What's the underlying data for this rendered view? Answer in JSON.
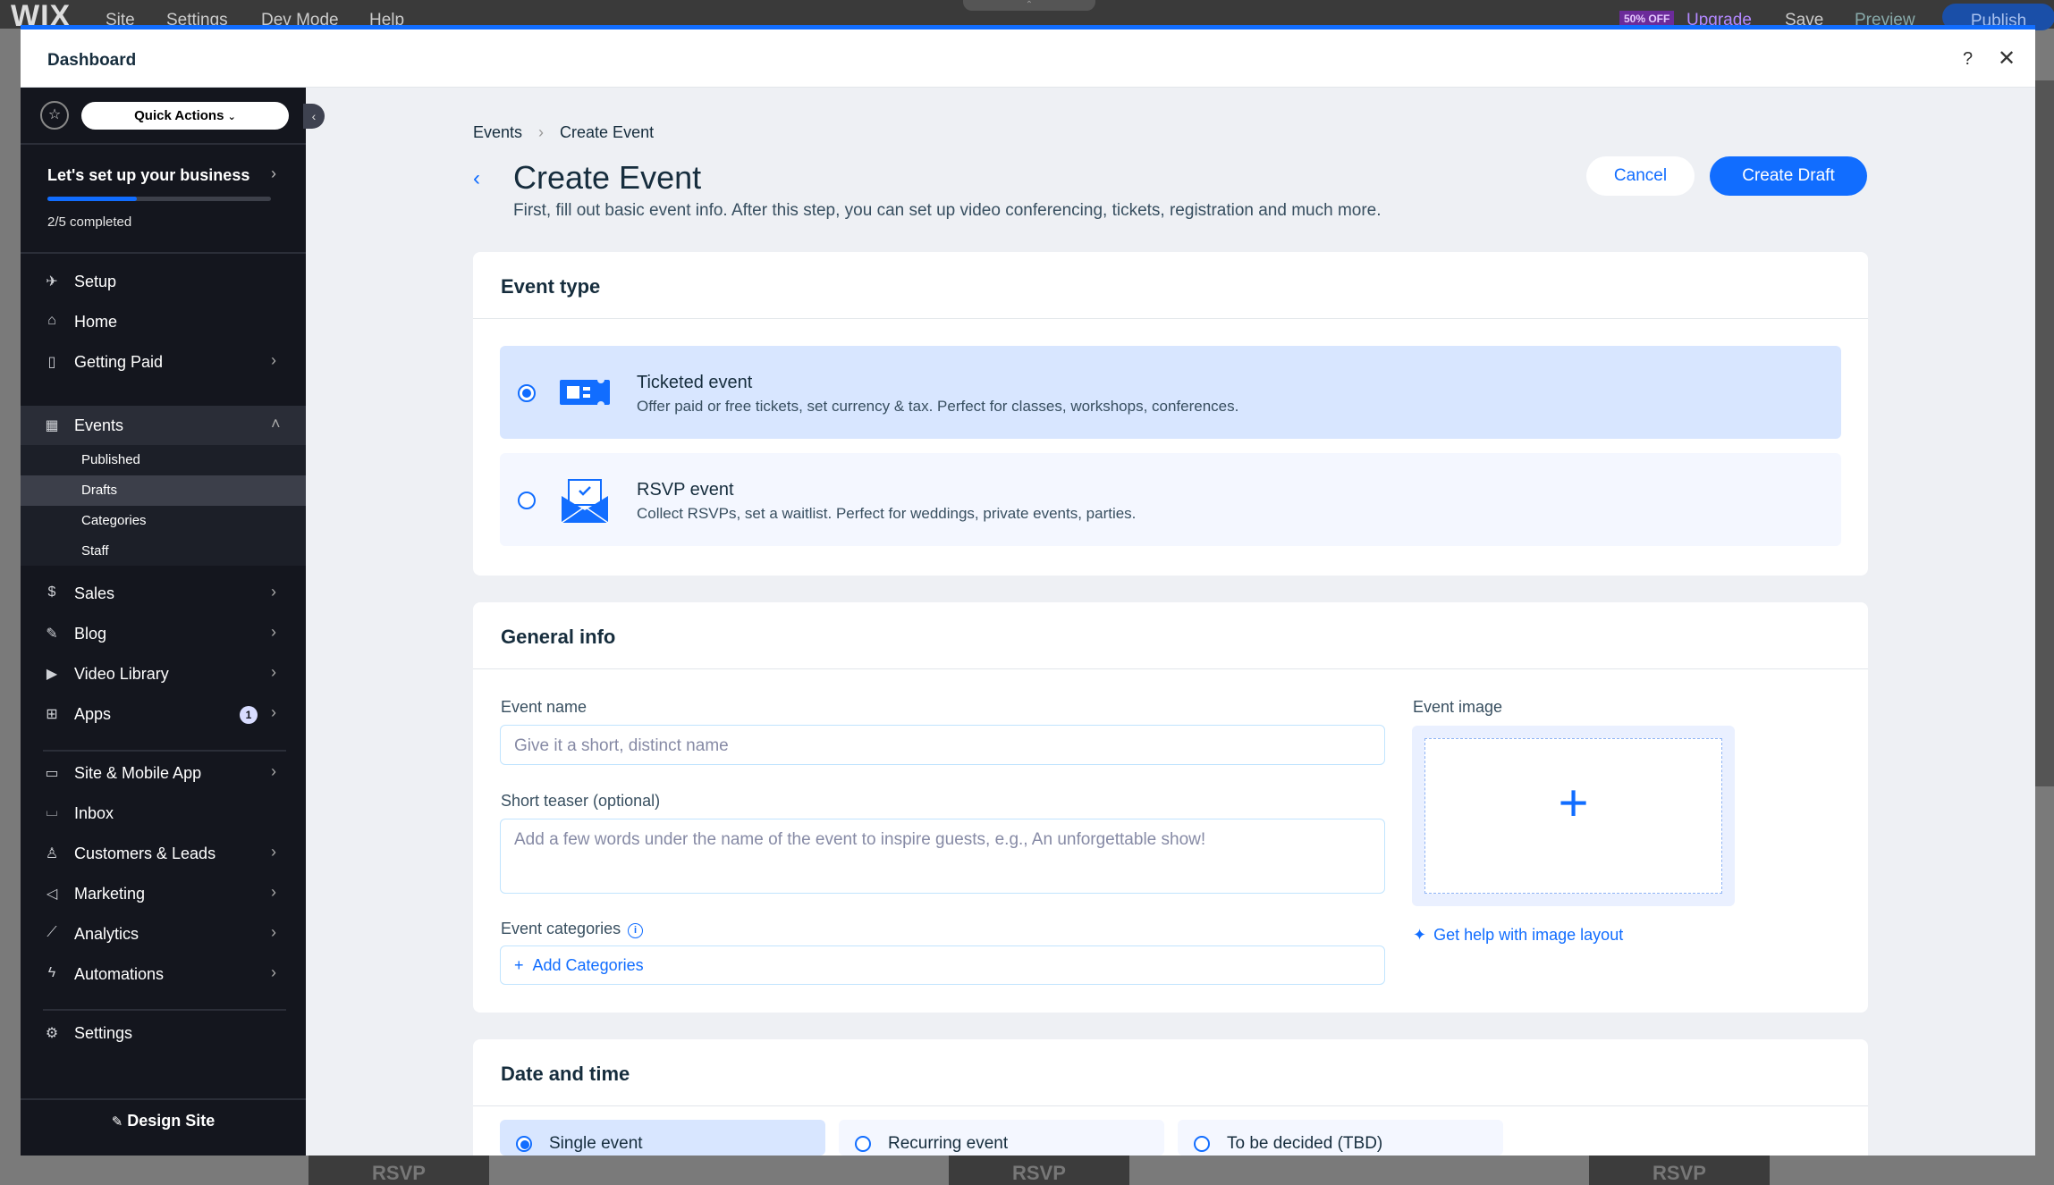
{
  "editor_bar": {
    "logo": "WIX",
    "menu": [
      "Site",
      "Settings",
      "Dev Mode",
      "Help"
    ],
    "promo_badge": "50% OFF",
    "upgrade": "Upgrade",
    "save": "Save",
    "preview": "Preview",
    "publish": "Publish"
  },
  "background_tiles": [
    "RSVP",
    "RSVP",
    "RSVP"
  ],
  "window": {
    "title": "Dashboard",
    "help_icon": "?",
    "close_icon": "✕"
  },
  "sidebar": {
    "quick_actions": "Quick Actions",
    "setup_title": "Let's set up your business",
    "setup_progress": "2/5 completed",
    "setup_progress_fraction": 0.4,
    "items": [
      {
        "label": "Setup",
        "icon": "rocket-icon"
      },
      {
        "label": "Home",
        "icon": "home-icon"
      },
      {
        "label": "Getting Paid",
        "icon": "document-icon"
      },
      {
        "label": "Events",
        "icon": "calendar-icon"
      },
      {
        "label": "Sales",
        "icon": "dollar-icon"
      },
      {
        "label": "Blog",
        "icon": "pen-icon"
      },
      {
        "label": "Video Library",
        "icon": "video-icon"
      },
      {
        "label": "Apps",
        "icon": "apps-icon",
        "badge": "1"
      },
      {
        "label": "Site & Mobile App",
        "icon": "devices-icon"
      },
      {
        "label": "Inbox",
        "icon": "inbox-icon"
      },
      {
        "label": "Customers & Leads",
        "icon": "people-icon"
      },
      {
        "label": "Marketing",
        "icon": "megaphone-icon"
      },
      {
        "label": "Analytics",
        "icon": "chart-icon"
      },
      {
        "label": "Automations",
        "icon": "bolt-icon"
      },
      {
        "label": "Settings",
        "icon": "gear-icon"
      }
    ],
    "events_sub": [
      "Published",
      "Drafts",
      "Categories",
      "Staff"
    ],
    "design_site": "Design Site"
  },
  "page": {
    "breadcrumb": [
      "Events",
      "Create Event"
    ],
    "title": "Create Event",
    "subtitle": "First, fill out basic event info. After this step, you can set up video conferencing, tickets, registration and much more.",
    "cancel": "Cancel",
    "create_draft": "Create Draft"
  },
  "event_type": {
    "title": "Event type",
    "options": [
      {
        "title": "Ticketed event",
        "desc": "Offer paid or free tickets, set currency & tax. Perfect for classes, workshops, conferences."
      },
      {
        "title": "RSVP event",
        "desc": "Collect RSVPs, set a waitlist. Perfect for weddings, private events, parties."
      }
    ]
  },
  "general_info": {
    "title": "General info",
    "event_name_label": "Event name",
    "event_name_placeholder": "Give it a short, distinct name",
    "teaser_label": "Short teaser (optional)",
    "teaser_placeholder": "Add a few words under the name of the event to inspire guests, e.g., An unforgettable show!",
    "categories_label": "Event categories",
    "add_categories": "Add Categories",
    "image_label": "Event image",
    "image_help": "Get help with image layout"
  },
  "date_time": {
    "title": "Date and time",
    "options": [
      "Single event",
      "Recurring event",
      "To be decided (TBD)"
    ]
  }
}
